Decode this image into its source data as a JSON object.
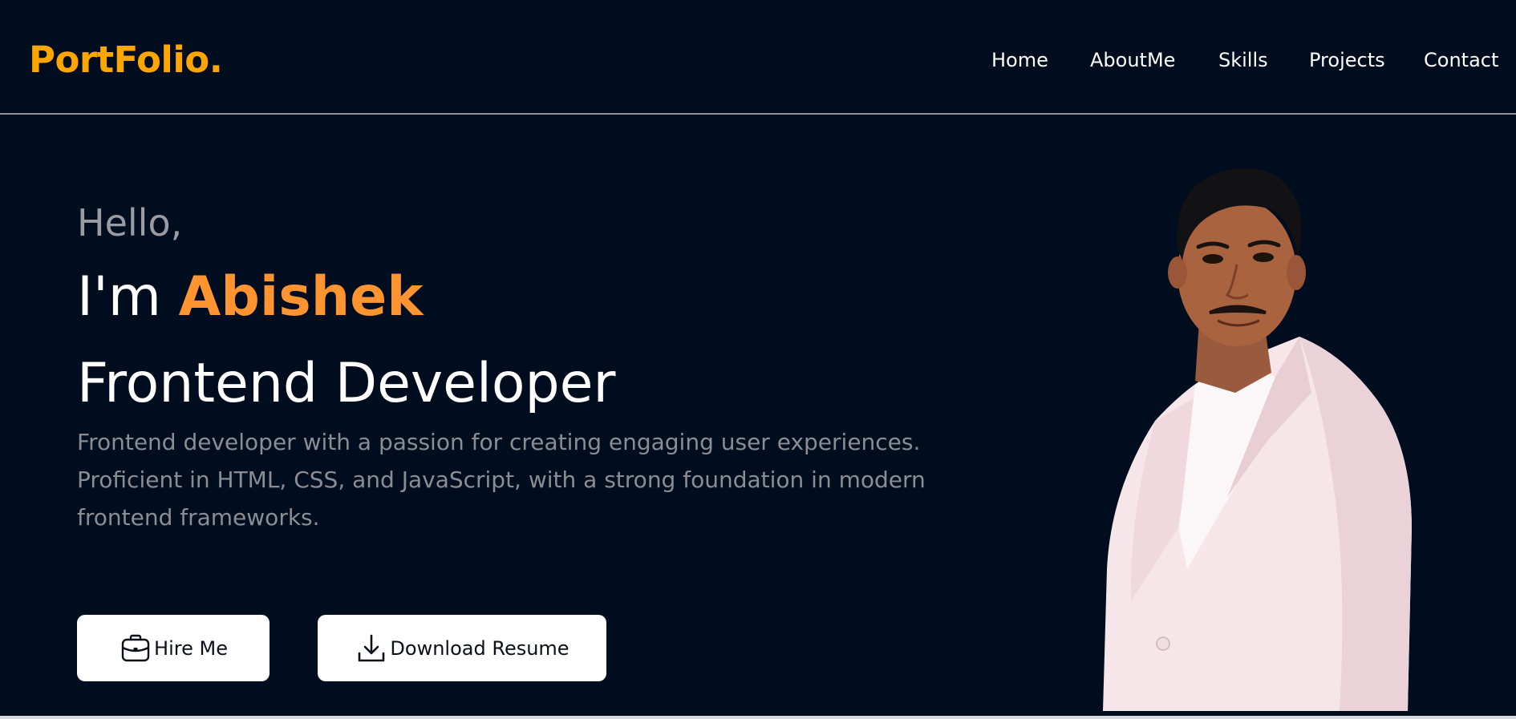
{
  "brand": {
    "logo_text": "PortFolio.",
    "accent_color": "#ffa500"
  },
  "nav": {
    "items": [
      {
        "label": "Home"
      },
      {
        "label": "AboutMe"
      },
      {
        "label": "Skills"
      },
      {
        "label": "Projects"
      },
      {
        "label": "Contact"
      }
    ]
  },
  "hero": {
    "greeting": "Hello,",
    "name_prefix": "I'm ",
    "name": "Abishek",
    "name_color": "#ff9431",
    "role": "Frontend Developer",
    "description": "Frontend developer with a passion for creating engaging user experiences. Proficient in HTML, CSS, and JavaScript, with a strong foundation in modern frontend frameworks.",
    "portrait_icon": "person-photo"
  },
  "actions": {
    "hire": {
      "label": "Hire Me",
      "icon": "briefcase-icon"
    },
    "resume": {
      "label": "Download Resume",
      "icon": "download-icon"
    }
  },
  "theme": {
    "background": "#000d1f",
    "text": "#ffffff",
    "muted_text": "#8b8d93"
  }
}
